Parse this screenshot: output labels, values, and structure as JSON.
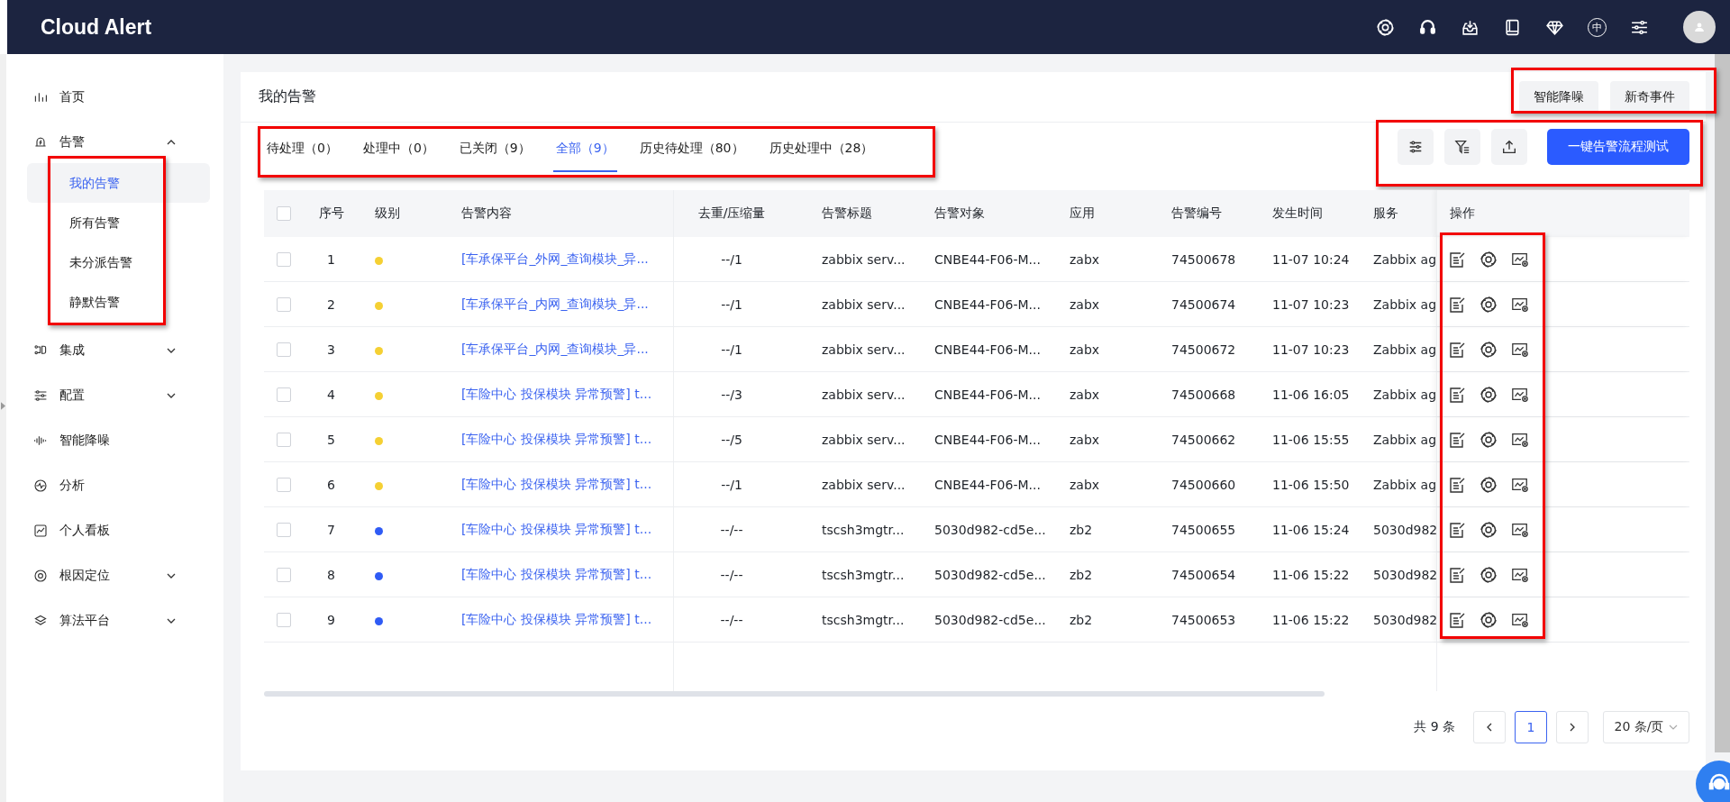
{
  "header": {
    "title": "Cloud Alert",
    "language_toggle": "中"
  },
  "sidebar": {
    "items": [
      {
        "label": "首页"
      },
      {
        "label": "告警",
        "expanded": true,
        "children_highlighted": true,
        "children": [
          {
            "label": "我的告警",
            "selected": true
          },
          {
            "label": "所有告警",
            "selected": false
          },
          {
            "label": "未分派告警",
            "selected": false
          },
          {
            "label": "静默告警",
            "selected": false
          }
        ]
      },
      {
        "label": "集成",
        "expanded": false
      },
      {
        "label": "配置",
        "expanded": false
      },
      {
        "label": "智能降噪"
      },
      {
        "label": "分析"
      },
      {
        "label": "个人看板"
      },
      {
        "label": "根因定位",
        "expanded": false
      },
      {
        "label": "算法平台",
        "expanded": false
      }
    ]
  },
  "page": {
    "title": "我的告警",
    "top_buttons": [
      "智能降噪",
      "新奇事件"
    ],
    "top_buttons_highlighted": true,
    "tabs": [
      {
        "label": "待处理（0）",
        "selected": false
      },
      {
        "label": "处理中（0）",
        "selected": false
      },
      {
        "label": "已关闭（9）",
        "selected": false
      },
      {
        "label": "全部（9）",
        "selected": true
      },
      {
        "label": "历史待处理（80）",
        "selected": false
      },
      {
        "label": "历史处理中（28）",
        "selected": false
      }
    ],
    "tabs_highlighted": true,
    "toolbar": {
      "primary_button": "一键告警流程测试",
      "highlighted": true
    },
    "table": {
      "select_all_checked": false,
      "actions_highlighted": true,
      "columns": [
        "序号",
        "级别",
        "告警内容",
        "去重/压缩量",
        "告警标题",
        "告警对象",
        "应用",
        "告警编号",
        "发生时间",
        "服务",
        "操作"
      ],
      "rows": [
        {
          "checked": false,
          "no": "1",
          "color": "#f5d033",
          "content": "[车承保平台_外网_查询模块_异...",
          "dedup": "--/1",
          "title": "zabbix serv...",
          "object": "CNBE44-F06-M...",
          "app": "zabx",
          "number": "74500678",
          "time": "11-07 10:24",
          "service": "Zabbix ag"
        },
        {
          "checked": false,
          "no": "2",
          "color": "#f5d033",
          "content": "[车承保平台_内网_查询模块_异...",
          "dedup": "--/1",
          "title": "zabbix serv...",
          "object": "CNBE44-F06-M...",
          "app": "zabx",
          "number": "74500674",
          "time": "11-07 10:23",
          "service": "Zabbix ag"
        },
        {
          "checked": false,
          "no": "3",
          "color": "#f5d033",
          "content": "[车承保平台_内网_查询模块_异...",
          "dedup": "--/1",
          "title": "zabbix serv...",
          "object": "CNBE44-F06-M...",
          "app": "zabx",
          "number": "74500672",
          "time": "11-07 10:23",
          "service": "Zabbix ag"
        },
        {
          "checked": false,
          "no": "4",
          "color": "#f5d033",
          "content": "[车险中心 投保模块 异常预警] t...",
          "dedup": "--/3",
          "title": "zabbix serv...",
          "object": "CNBE44-F06-M...",
          "app": "zabx",
          "number": "74500668",
          "time": "11-06 16:05",
          "service": "Zabbix ag"
        },
        {
          "checked": false,
          "no": "5",
          "color": "#f5d033",
          "content": "[车险中心 投保模块 异常预警] t...",
          "dedup": "--/5",
          "title": "zabbix serv...",
          "object": "CNBE44-F06-M...",
          "app": "zabx",
          "number": "74500662",
          "time": "11-06 15:55",
          "service": "Zabbix ag"
        },
        {
          "checked": false,
          "no": "6",
          "color": "#f5d033",
          "content": "[车险中心 投保模块 异常预警] t...",
          "dedup": "--/1",
          "title": "zabbix serv...",
          "object": "CNBE44-F06-M...",
          "app": "zabx",
          "number": "74500660",
          "time": "11-06 15:50",
          "service": "Zabbix ag"
        },
        {
          "checked": false,
          "no": "7",
          "color": "#2f5bf5",
          "content": "[车险中心 投保模块 异常预警] t...",
          "dedup": "--/--",
          "title": "tscsh3mgtr...",
          "object": "5030d982-cd5e...",
          "app": "zb2",
          "number": "74500655",
          "time": "11-06 15:24",
          "service": "5030d982"
        },
        {
          "checked": false,
          "no": "8",
          "color": "#2f5bf5",
          "content": "[车险中心 投保模块 异常预警] t...",
          "dedup": "--/--",
          "title": "tscsh3mgtr...",
          "object": "5030d982-cd5e...",
          "app": "zb2",
          "number": "74500654",
          "time": "11-06 15:22",
          "service": "5030d982"
        },
        {
          "checked": false,
          "no": "9",
          "color": "#2f5bf5",
          "content": "[车险中心 投保模块 异常预警] t...",
          "dedup": "--/--",
          "title": "tscsh3mgtr...",
          "object": "5030d982-cd5e...",
          "app": "zb2",
          "number": "74500653",
          "time": "11-06 15:22",
          "service": "5030d982"
        }
      ]
    },
    "pagination": {
      "total": "共 9 条",
      "pages": [
        {
          "label": "1",
          "selected": true
        }
      ],
      "page_size": "20 条/页"
    }
  }
}
